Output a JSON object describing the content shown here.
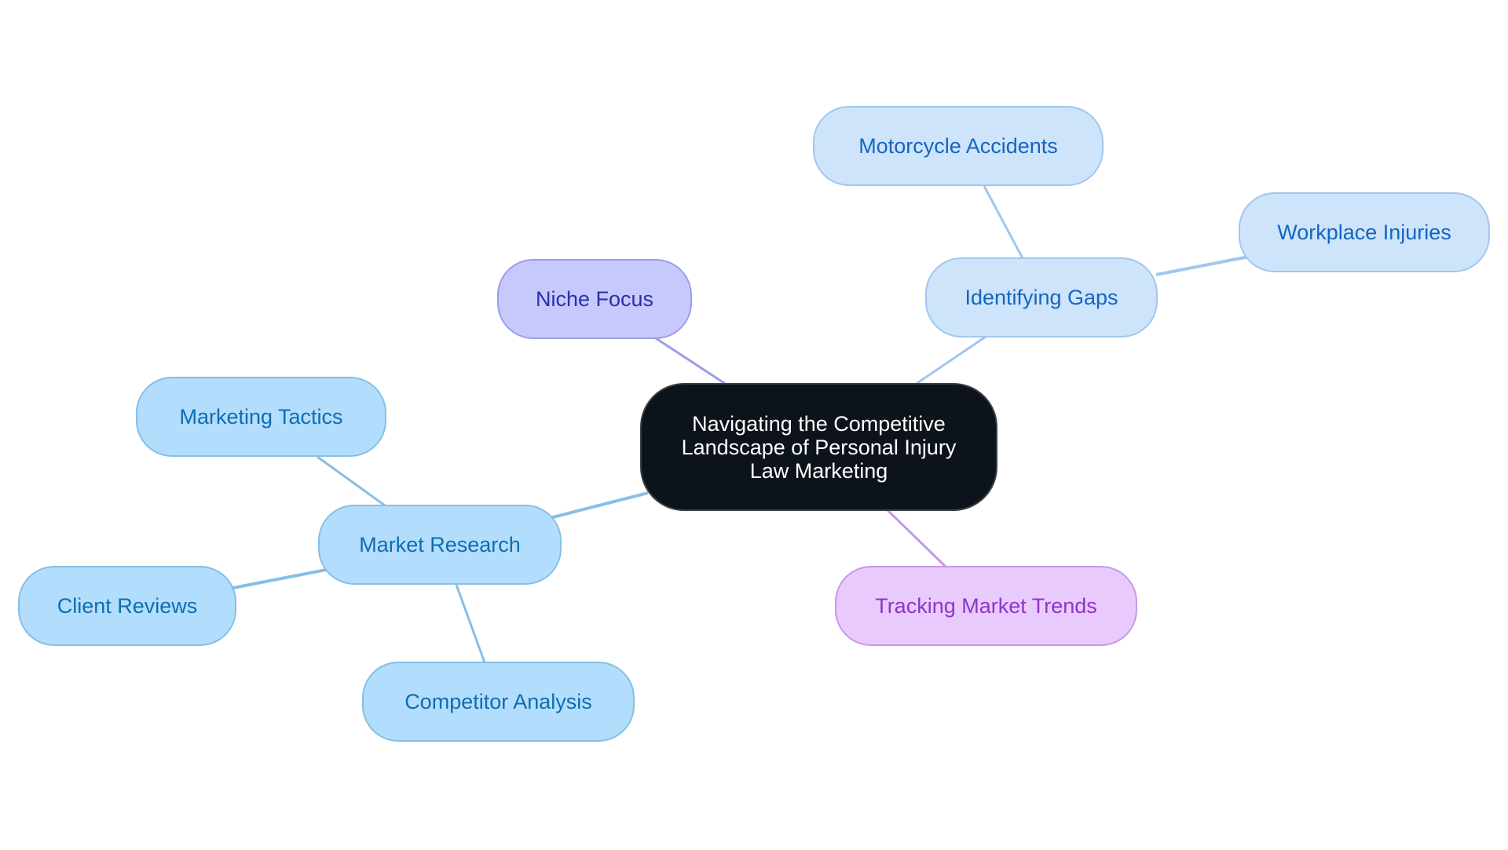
{
  "diagram": {
    "type": "mind-map",
    "root": {
      "id": "root",
      "label": "Navigating the Competitive Landscape of Personal Injury Law Marketing"
    },
    "nodes": [
      {
        "id": "niche-focus",
        "label": "Niche Focus",
        "parent": "root",
        "style": "violet"
      },
      {
        "id": "identifying-gaps",
        "label": "Identifying Gaps",
        "parent": "root",
        "style": "ltblue"
      },
      {
        "id": "motorcycle-accidents",
        "label": "Motorcycle Accidents",
        "parent": "identifying-gaps",
        "style": "ltblue"
      },
      {
        "id": "workplace-injuries",
        "label": "Workplace Injuries",
        "parent": "identifying-gaps",
        "style": "ltblue"
      },
      {
        "id": "market-research",
        "label": "Market Research",
        "parent": "root",
        "style": "skyblue"
      },
      {
        "id": "marketing-tactics",
        "label": "Marketing Tactics",
        "parent": "market-research",
        "style": "skyblue"
      },
      {
        "id": "client-reviews",
        "label": "Client Reviews",
        "parent": "market-research",
        "style": "skyblue"
      },
      {
        "id": "competitor-analysis",
        "label": "Competitor Analysis",
        "parent": "market-research",
        "style": "skyblue"
      },
      {
        "id": "tracking-market-trends",
        "label": "Tracking Market Trends",
        "parent": "root",
        "style": "purple"
      }
    ],
    "colors": {
      "root_fill": "#0d131b",
      "root_text": "#ffffff",
      "violet_fill": "#c7c9fd",
      "violet_text": "#2a2fa8",
      "violet_edge": "#9b9ee6",
      "ltblue_fill": "#cde4fb",
      "ltblue_text": "#1565c0",
      "ltblue_edge": "#a2c6ed",
      "skyblue_fill": "#b3ddfc",
      "skyblue_text": "#0f6db0",
      "skyblue_edge": "#86bfe6",
      "purple_fill": "#e9cafc",
      "purple_text": "#8e35c9",
      "purple_edge": "#c49ae6"
    }
  }
}
